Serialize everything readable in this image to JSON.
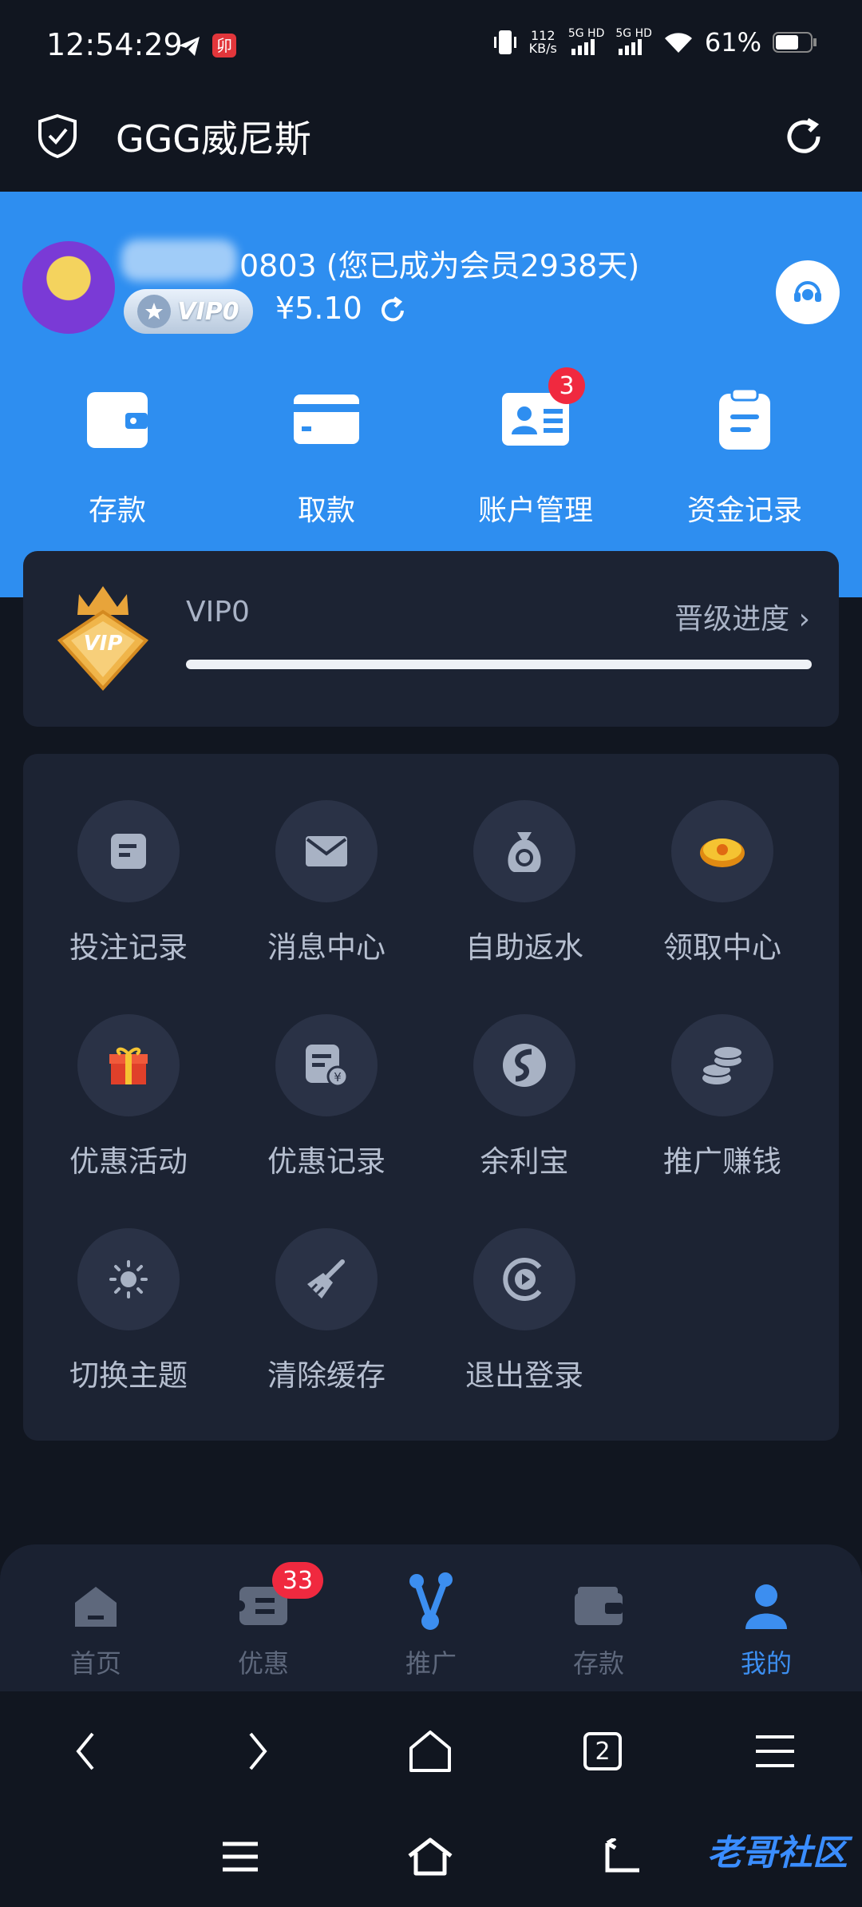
{
  "status_bar": {
    "time": "12:54:29",
    "speed": "112",
    "speed_unit": "KB/s",
    "network1": "5G HD",
    "network2": "5G HD",
    "battery": "61%"
  },
  "app_bar": {
    "title": "GGG威尼斯"
  },
  "profile": {
    "username": "0803 (您已成为会员2938天)",
    "vip_badge": "VIP0",
    "balance": "¥5.10"
  },
  "quick_actions": [
    {
      "label": "存款",
      "icon": "wallet-icon"
    },
    {
      "label": "取款",
      "icon": "card-icon"
    },
    {
      "label": "账户管理",
      "icon": "id-card-icon",
      "badge": "3"
    },
    {
      "label": "资金记录",
      "icon": "clipboard-icon"
    }
  ],
  "vip_card": {
    "level": "VIP0",
    "progress_label": "晋级进度",
    "progress": 1.0,
    "logo_text": "VIP"
  },
  "menu_grid": [
    {
      "label": "投注记录",
      "icon": "document-icon"
    },
    {
      "label": "消息中心",
      "icon": "envelope-icon"
    },
    {
      "label": "自助返水",
      "icon": "money-bag-icon"
    },
    {
      "label": "领取中心",
      "icon": "gold-coin-icon"
    },
    {
      "label": "优惠活动",
      "icon": "gift-icon"
    },
    {
      "label": "优惠记录",
      "icon": "yuan-record-icon"
    },
    {
      "label": "余利宝",
      "icon": "yulibao-icon"
    },
    {
      "label": "推广赚钱",
      "icon": "coin-stack-icon"
    },
    {
      "label": "切换主题",
      "icon": "sun-icon"
    },
    {
      "label": "清除缓存",
      "icon": "broom-icon"
    },
    {
      "label": "退出登录",
      "icon": "logout-icon"
    }
  ],
  "tab_bar": [
    {
      "label": "首页",
      "icon": "home-icon"
    },
    {
      "label": "优惠",
      "icon": "ticket-icon",
      "badge": "33"
    },
    {
      "label": "推广",
      "icon": "share-icon",
      "highlight": true
    },
    {
      "label": "存款",
      "icon": "wallet-icon"
    },
    {
      "label": "我的",
      "icon": "person-icon",
      "active": true
    }
  ],
  "browser_bar": {
    "tab_count": "2"
  },
  "watermark": "老哥社区",
  "colors": {
    "header_blue": "#2e8ef0",
    "background": "#111620",
    "card": "#1c2333",
    "accent": "#3c8ef0",
    "badge_red": "#f0293f"
  }
}
